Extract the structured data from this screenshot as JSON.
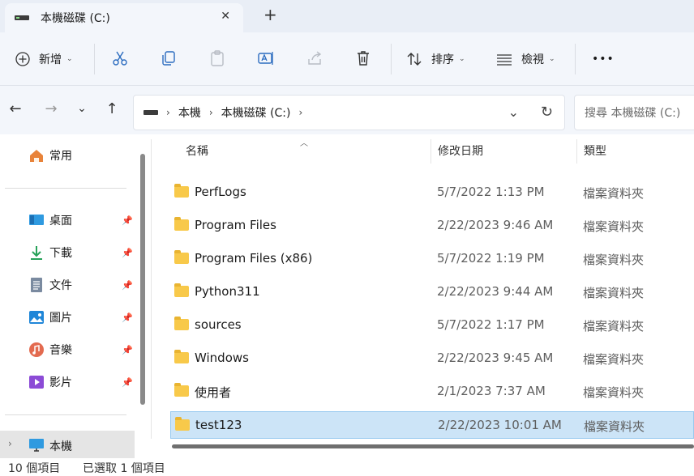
{
  "window": {
    "tab_title": "本機磁碟 (C:)",
    "close_glyph": "✕",
    "new_tab_glyph": "+"
  },
  "toolbar": {
    "new_label": "新增",
    "sort_label": "排序",
    "view_label": "檢視",
    "more_glyph": "•••",
    "icons": [
      "plus-circle-icon",
      "cut-icon",
      "copy-icon",
      "paste-icon",
      "rename-icon",
      "share-icon",
      "delete-icon",
      "sort-icon",
      "view-icon"
    ]
  },
  "navigation": {
    "back_glyph": "←",
    "forward_glyph": "→",
    "recent_glyph": "⌄",
    "up_glyph": "↑"
  },
  "address": {
    "breadcrumbs": [
      "本機",
      "本機磁碟 (C:)"
    ],
    "separator": "›",
    "dropdown_glyph": "⌄",
    "refresh_glyph": "↻"
  },
  "search": {
    "placeholder": "搜尋 本機磁碟 (C:)"
  },
  "sidebar": {
    "home_label": "常用",
    "quick_access": [
      {
        "label": "桌面",
        "icon": "desktop-icon",
        "pinned": true
      },
      {
        "label": "下載",
        "icon": "download-icon",
        "pinned": true
      },
      {
        "label": "文件",
        "icon": "document-icon",
        "pinned": true
      },
      {
        "label": "圖片",
        "icon": "pictures-icon",
        "pinned": true
      },
      {
        "label": "音樂",
        "icon": "music-icon",
        "pinned": true
      },
      {
        "label": "影片",
        "icon": "video-icon",
        "pinned": true
      }
    ],
    "this_pc_label": "本機",
    "pin_glyph": "📌"
  },
  "columns": {
    "name": "名稱",
    "date": "修改日期",
    "type": "類型"
  },
  "files": [
    {
      "name": "PerfLogs",
      "date": "5/7/2022 1:13 PM",
      "type": "檔案資料夾",
      "selected": false
    },
    {
      "name": "Program Files",
      "date": "2/22/2023 9:46 AM",
      "type": "檔案資料夾",
      "selected": false
    },
    {
      "name": "Program Files (x86)",
      "date": "5/7/2022 1:19 PM",
      "type": "檔案資料夾",
      "selected": false
    },
    {
      "name": "Python311",
      "date": "2/22/2023 9:44 AM",
      "type": "檔案資料夾",
      "selected": false
    },
    {
      "name": "sources",
      "date": "5/7/2022 1:17 PM",
      "type": "檔案資料夾",
      "selected": false
    },
    {
      "name": "Windows",
      "date": "2/22/2023 9:45 AM",
      "type": "檔案資料夾",
      "selected": false
    },
    {
      "name": "使用者",
      "date": "2/1/2023 7:37 AM",
      "type": "檔案資料夾",
      "selected": false
    },
    {
      "name": "test123",
      "date": "2/22/2023 10:01 AM",
      "type": "檔案資料夾",
      "selected": true
    }
  ],
  "status": {
    "item_count": "10 個項目",
    "selected": "已選取 1 個項目"
  },
  "colors": {
    "accent": "#0067c0",
    "selection": "#cce4f7",
    "folder": "#f8c94a"
  }
}
